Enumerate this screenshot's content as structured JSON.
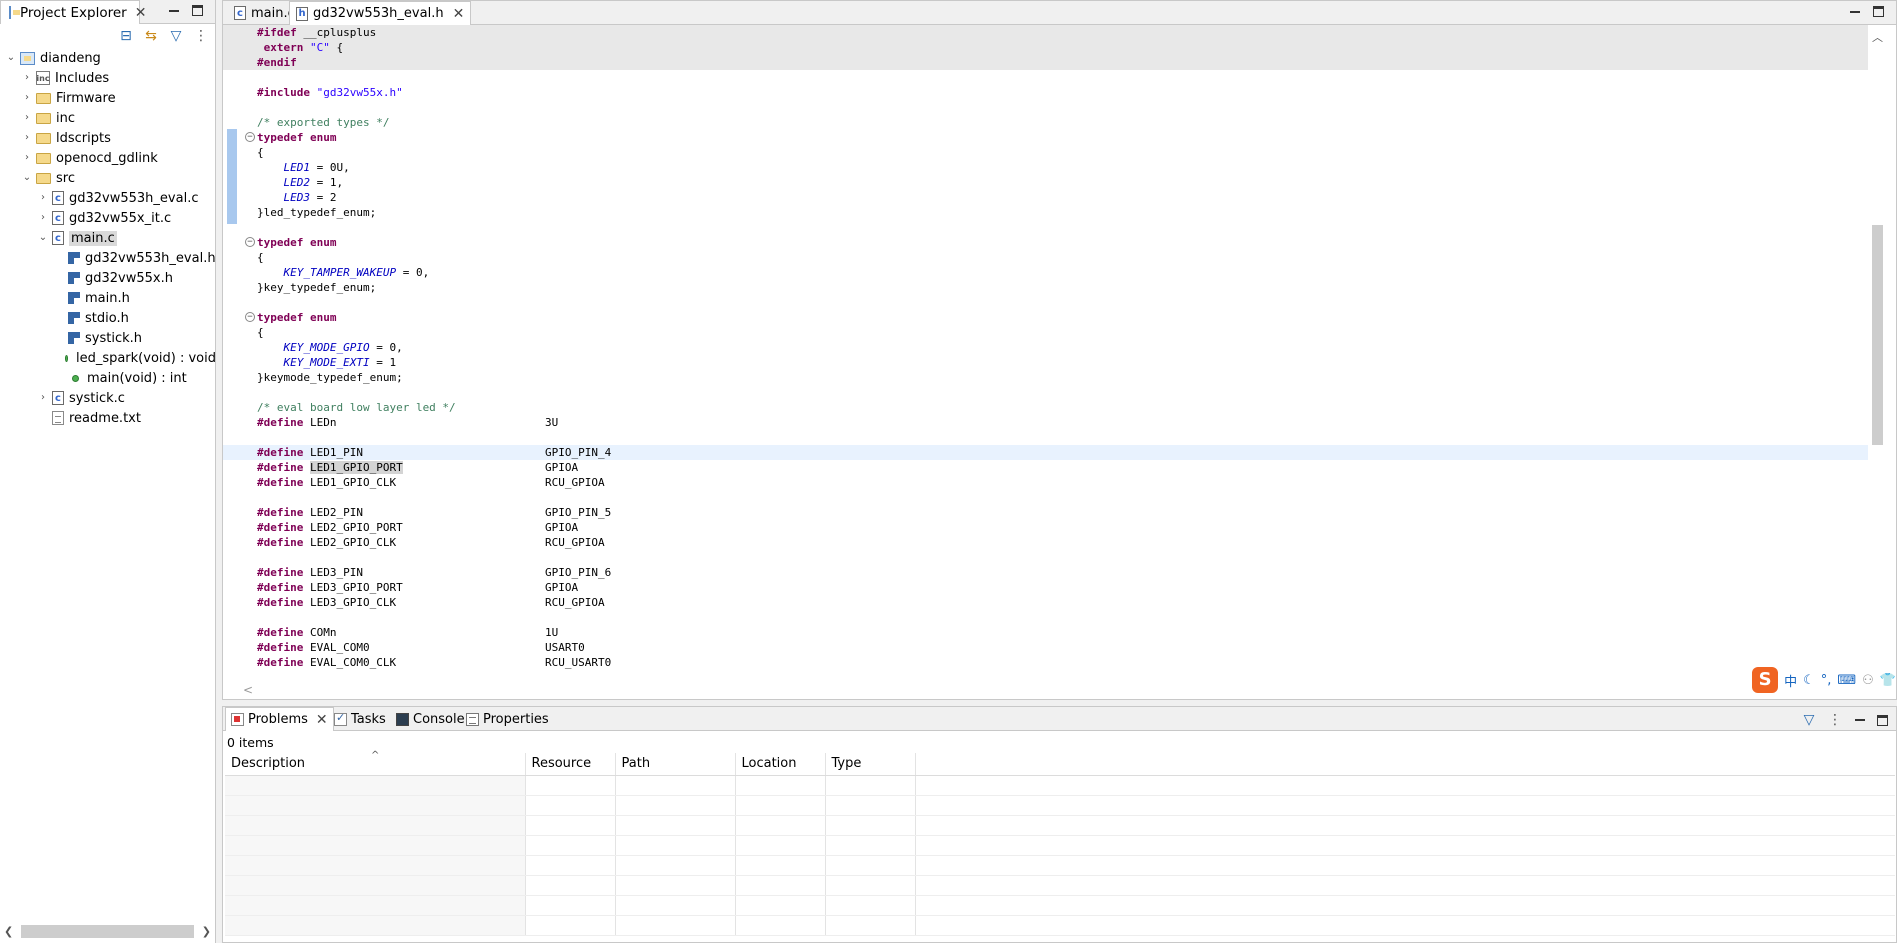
{
  "explorer": {
    "title": "Project Explorer",
    "tree": [
      {
        "label": "diandeng",
        "icon": "project-icon",
        "depth": 0,
        "twist": "open"
      },
      {
        "label": "Includes",
        "icon": "includes-icon",
        "depth": 1,
        "twist": "closed"
      },
      {
        "label": "Firmware",
        "icon": "folder-icon",
        "depth": 1,
        "twist": "closed"
      },
      {
        "label": "inc",
        "icon": "folder-icon",
        "depth": 1,
        "twist": "closed"
      },
      {
        "label": "ldscripts",
        "icon": "folder-icon",
        "depth": 1,
        "twist": "closed"
      },
      {
        "label": "openocd_gdlink",
        "icon": "folder-icon",
        "depth": 1,
        "twist": "closed"
      },
      {
        "label": "src",
        "icon": "folder-icon",
        "depth": 1,
        "twist": "open"
      },
      {
        "label": "gd32vw553h_eval.c",
        "icon": "c-file-icon",
        "depth": 2,
        "twist": "closed"
      },
      {
        "label": "gd32vw55x_it.c",
        "icon": "c-file-icon",
        "depth": 2,
        "twist": "closed"
      },
      {
        "label": "main.c",
        "icon": "c-file-icon",
        "depth": 2,
        "twist": "open",
        "selected": true
      },
      {
        "label": "gd32vw553h_eval.h",
        "icon": "header-include-icon",
        "depth": 3,
        "twist": ""
      },
      {
        "label": "gd32vw55x.h",
        "icon": "header-include-icon",
        "depth": 3,
        "twist": ""
      },
      {
        "label": "main.h",
        "icon": "header-include-icon",
        "depth": 3,
        "twist": ""
      },
      {
        "label": "stdio.h",
        "icon": "header-include-icon",
        "depth": 3,
        "twist": ""
      },
      {
        "label": "systick.h",
        "icon": "header-include-icon",
        "depth": 3,
        "twist": ""
      },
      {
        "label": "led_spark(void) : void",
        "icon": "function-icon",
        "depth": 3,
        "twist": ""
      },
      {
        "label": "main(void) : int",
        "icon": "function-icon",
        "depth": 3,
        "twist": ""
      },
      {
        "label": "systick.c",
        "icon": "c-file-icon",
        "depth": 2,
        "twist": "closed"
      },
      {
        "label": "readme.txt",
        "icon": "text-file-icon",
        "depth": 2,
        "twist": ""
      }
    ]
  },
  "editor": {
    "tabs": [
      {
        "label": "main.c",
        "icon": "c-file-icon",
        "active": false
      },
      {
        "label": "gd32vw553h_eval.h",
        "icon": "h-file-icon",
        "active": true
      }
    ],
    "lines": [
      {
        "html": "<span class=\"pp\">#ifdef</span> __cplusplus",
        "shaded": true
      },
      {
        "html": " <span class=\"kw\">extern</span> <span class=\"str\">\"C\"</span> {",
        "shaded": true
      },
      {
        "html": "<span class=\"pp\">#endif</span>",
        "shaded": true
      },
      {
        "html": ""
      },
      {
        "html": "<span class=\"pp\">#include</span> <span class=\"str\">\"gd32vw55x.h\"</span>"
      },
      {
        "html": ""
      },
      {
        "html": "<span class=\"cmt\">/* exported types */</span>"
      },
      {
        "html": "<span class=\"kw\">typedef</span> <span class=\"kw\">enum</span>",
        "fold": true
      },
      {
        "html": "{"
      },
      {
        "html": "    <span class=\"en\">LED1</span> = 0U,"
      },
      {
        "html": "    <span class=\"en\">LED2</span> = 1,"
      },
      {
        "html": "    <span class=\"en\">LED3</span> = 2"
      },
      {
        "html": "}led_typedef_enum;"
      },
      {
        "html": ""
      },
      {
        "html": "<span class=\"kw\">typedef</span> <span class=\"kw\">enum</span>",
        "fold": true
      },
      {
        "html": "{"
      },
      {
        "html": "    <span class=\"en\">KEY_TAMPER_WAKEUP</span> = 0,"
      },
      {
        "html": "}key_typedef_enum;"
      },
      {
        "html": ""
      },
      {
        "html": "<span class=\"kw\">typedef</span> <span class=\"kw\">enum</span>",
        "fold": true
      },
      {
        "html": "{"
      },
      {
        "html": "    <span class=\"en\">KEY_MODE_GPIO</span> = 0,"
      },
      {
        "html": "    <span class=\"en\">KEY_MODE_EXTI</span> = 1"
      },
      {
        "html": "}keymode_typedef_enum;"
      },
      {
        "html": ""
      },
      {
        "html": "<span class=\"cmt\">/* eval board low layer led */</span>"
      },
      {
        "html": "<span class=\"pp\">#define</span> LEDn",
        "val": "3U"
      },
      {
        "html": ""
      },
      {
        "html": "<span class=\"pp\">#define</span> LED1_PIN",
        "val": "GPIO_PIN_4",
        "cur": true
      },
      {
        "html": "<span class=\"pp\">#define</span> <span class=\"hl\">LED1_GPIO_PORT</span>",
        "val": "GPIOA"
      },
      {
        "html": "<span class=\"pp\">#define</span> LED1_GPIO_CLK",
        "val": "RCU_GPIOA"
      },
      {
        "html": ""
      },
      {
        "html": "<span class=\"pp\">#define</span> LED2_PIN",
        "val": "GPIO_PIN_5"
      },
      {
        "html": "<span class=\"pp\">#define</span> LED2_GPIO_PORT",
        "val": "GPIOA"
      },
      {
        "html": "<span class=\"pp\">#define</span> LED2_GPIO_CLK",
        "val": "RCU_GPIOA"
      },
      {
        "html": ""
      },
      {
        "html": "<span class=\"pp\">#define</span> LED3_PIN",
        "val": "GPIO_PIN_6"
      },
      {
        "html": "<span class=\"pp\">#define</span> LED3_GPIO_PORT",
        "val": "GPIOA"
      },
      {
        "html": "<span class=\"pp\">#define</span> LED3_GPIO_CLK",
        "val": "RCU_GPIOA"
      },
      {
        "html": ""
      },
      {
        "html": "<span class=\"pp\">#define</span> COMn",
        "val": "1U"
      },
      {
        "html": "<span class=\"pp\">#define</span> EVAL_COM0",
        "val": "USART0"
      },
      {
        "html": "<span class=\"pp\">#define</span> EVAL_COM0_CLK",
        "val": "RCU_USART0"
      }
    ],
    "ime": {
      "logo": "S",
      "mode": "中"
    }
  },
  "problems": {
    "tabs": [
      {
        "label": "Problems",
        "icon": "problems-icon",
        "active": true
      },
      {
        "label": "Tasks",
        "icon": "tasks-icon"
      },
      {
        "label": "Console",
        "icon": "console-icon"
      },
      {
        "label": "Properties",
        "icon": "properties-icon"
      }
    ],
    "count": "0 items",
    "columns": [
      "Description",
      "Resource",
      "Path",
      "Location",
      "Type"
    ],
    "sort_caret": "^"
  },
  "colors": {
    "keyword": "#7f0055",
    "string": "#2a00ff",
    "comment": "#3f7f5f",
    "enumerator": "#0000c0",
    "current_line": "#e8f2fe"
  }
}
